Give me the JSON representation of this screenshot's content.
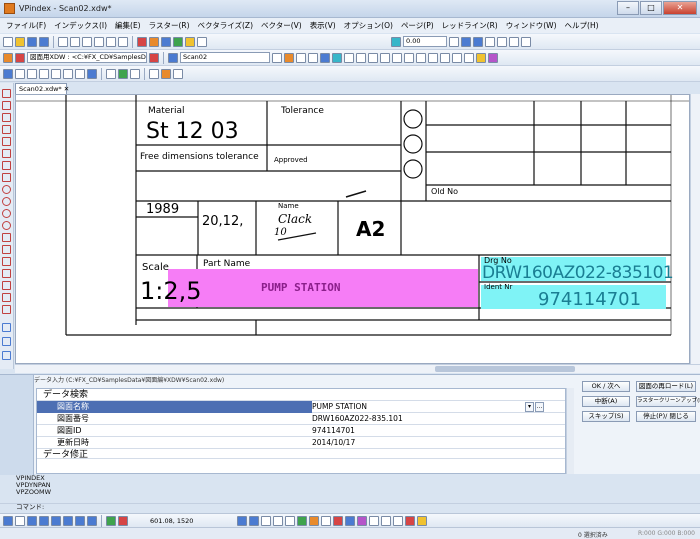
{
  "window": {
    "title": "VPindex - Scan02.xdw*"
  },
  "menu": [
    "ファイル(F)",
    "インデックス(I)",
    "編集(E)",
    "ラスター(R)",
    "ベクタライズ(Z)",
    "ベクター(V)",
    "表示(V)",
    "オプション(O)",
    "ページ(P)",
    "レッドライン(R)",
    "ウィンドウ(W)",
    "ヘルプ(H)"
  ],
  "toolbar2": {
    "zoom": "0.00"
  },
  "toolbar3": {
    "path": "図面用XDW : <C:¥FX_CD¥SamplesD",
    "file": "Scan02"
  },
  "document": {
    "tab": "Scan02.xdw*"
  },
  "drawing": {
    "material_label": "Material",
    "material_value": "St 12  03",
    "tolerance_label": "Tolerance",
    "free_dim": "Free dimensions  tolerance",
    "approved": "Approved",
    "old_no": "Old No",
    "year": "1989",
    "date": "20,12,",
    "name_label": "Name",
    "name_sig1": "Clack",
    "name_sig2": "10",
    "size": "A2",
    "scale_label": "Scale",
    "scale_value": "1:2,5",
    "part_label": "Part  Name",
    "part_value": "PUMP STATION",
    "drg_label": "Drg  No",
    "drg_value": "DRW160AZ022-835101",
    "ident_label": "Ident  Nr",
    "ident_value": "974114701"
  },
  "panel": {
    "header": "データ入力 (C:¥FX_CD¥SamplesData¥図面編¥XDW¥Scan02.xdw)",
    "section": "データ検索",
    "rows": [
      {
        "label": "図面名称",
        "value": "PUMP STATION"
      },
      {
        "label": "図面番号",
        "value": "DRW160AZ022-835.101"
      },
      {
        "label": "図面ID",
        "value": "974114701"
      },
      {
        "label": "更新日時",
        "value": "2014/10/17"
      }
    ],
    "section2": "データ修正",
    "buttons": {
      "ok": "OK / 次へ",
      "reload": "図面の再ロード(L)",
      "stop": "中断(A)",
      "cleanup": "ラスタークリーンアップ(R)...",
      "skip": "スキップ(S)",
      "close": "停止(P)/ 閉じる"
    }
  },
  "commands": [
    "VPINDEX",
    "VPDYNPAN",
    "VPZOOMW"
  ],
  "command_prompt": "コマンド:",
  "bottombar": {
    "coords": "601.08, 1520"
  },
  "statusbar": {
    "status": "0 選択済み",
    "color": "R:000 G:000 B:000"
  },
  "colors": {
    "highlight_magenta": "#f67df6",
    "highlight_cyan": "#7ff3f6",
    "selection": "#4d6fb3"
  }
}
